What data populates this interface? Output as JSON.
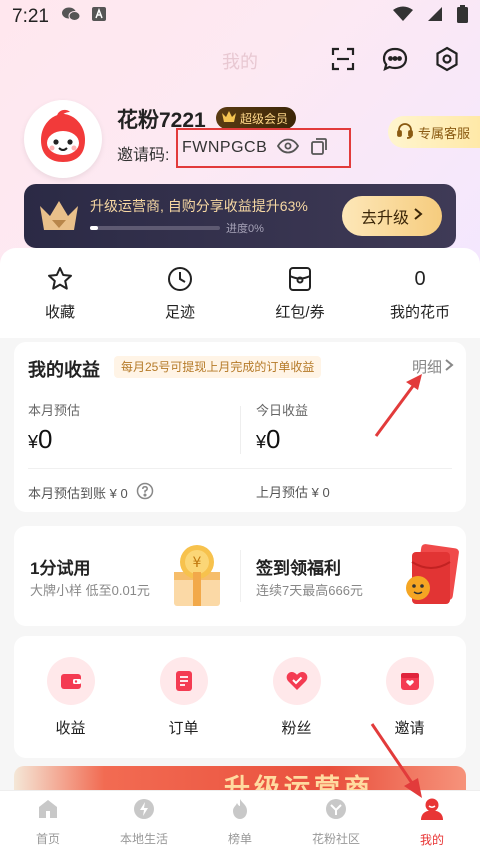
{
  "status_bar": {
    "time": "7:21"
  },
  "header": {
    "title": "我的"
  },
  "profile": {
    "nickname": "花粉7221",
    "vip_label": "超级会员",
    "invite_label": "邀请码:",
    "invite_code": "FWNPGCB",
    "service_label": "专属客服"
  },
  "upgrade": {
    "text": "升级运营商, 自购分享收益提升63%",
    "progress_label": "进度0%",
    "progress": 0.06,
    "button_label": "去升级"
  },
  "quick_links": [
    {
      "label": "收藏",
      "icon": "star-icon"
    },
    {
      "label": "足迹",
      "icon": "clock-icon"
    },
    {
      "label": "红包/券",
      "icon": "coupon-icon"
    },
    {
      "label": "我的花币",
      "value": "0"
    }
  ],
  "earnings": {
    "title": "我的收益",
    "tip": "每月25号可提现上月完成的订单收益",
    "detail_label": "明细",
    "month_estimate_label": "本月预估",
    "month_estimate_value": "0",
    "today_label": "今日收益",
    "today_value": "0",
    "currency": "¥",
    "month_settled": "本月预估到账 ¥ 0",
    "last_month": "上月预估 ¥ 0"
  },
  "promos": [
    {
      "title": "1分试用",
      "subtitle": "大牌小样 低至0.01元"
    },
    {
      "title": "签到领福利",
      "subtitle": "连续7天最高666元"
    }
  ],
  "tools": [
    {
      "label": "收益",
      "icon": "wallet-icon"
    },
    {
      "label": "订单",
      "icon": "order-icon"
    },
    {
      "label": "粉丝",
      "icon": "heart-icon"
    },
    {
      "label": "邀请",
      "icon": "invite-icon"
    }
  ],
  "banner": {
    "text": "升级运营商"
  },
  "tabbar": [
    {
      "label": "首页",
      "icon": "home-icon",
      "active": false
    },
    {
      "label": "本地生活",
      "icon": "lightning-icon",
      "active": false
    },
    {
      "label": "榜单",
      "icon": "fire-icon",
      "active": false
    },
    {
      "label": "花粉社区",
      "icon": "community-icon",
      "active": false
    },
    {
      "label": "我的",
      "icon": "profile-icon",
      "active": true
    }
  ],
  "colors": {
    "accent": "#e83535",
    "annotation": "#e23b3b"
  }
}
